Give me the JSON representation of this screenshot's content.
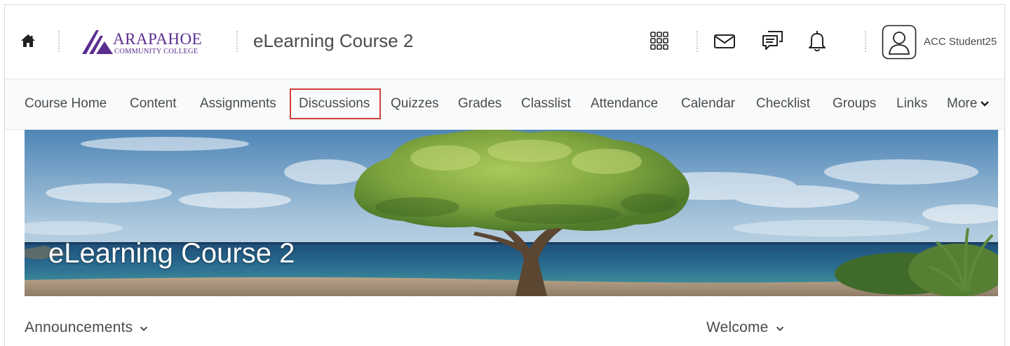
{
  "header": {
    "course_title": "eLearning Course 2",
    "user_name": "ACC Student25",
    "logo": {
      "name_line1": "ARAPAHOE",
      "name_line2": "COMMUNITY COLLEGE",
      "color": "#5b2d8e"
    },
    "icons": [
      "home-icon",
      "apps-grid-icon",
      "mail-icon",
      "chat-icon",
      "bell-icon",
      "user-avatar-icon"
    ]
  },
  "nav": {
    "items": [
      {
        "label": "Course Home"
      },
      {
        "label": "Content"
      },
      {
        "label": "Assignments"
      },
      {
        "label": "Discussions",
        "highlighted": true
      },
      {
        "label": "Quizzes"
      },
      {
        "label": "Grades"
      },
      {
        "label": "Classlist"
      },
      {
        "label": "Attendance"
      },
      {
        "label": "Calendar"
      },
      {
        "label": "Checklist"
      },
      {
        "label": "Groups"
      },
      {
        "label": "Links"
      },
      {
        "label": "More"
      }
    ]
  },
  "banner": {
    "title": "eLearning Course 2"
  },
  "widgets": {
    "announcements": {
      "title": "Announcements"
    },
    "welcome": {
      "title": "Welcome"
    }
  },
  "colors": {
    "highlight": "#d23d3d",
    "text": "#494c4e",
    "brand": "#5b2d8e"
  }
}
